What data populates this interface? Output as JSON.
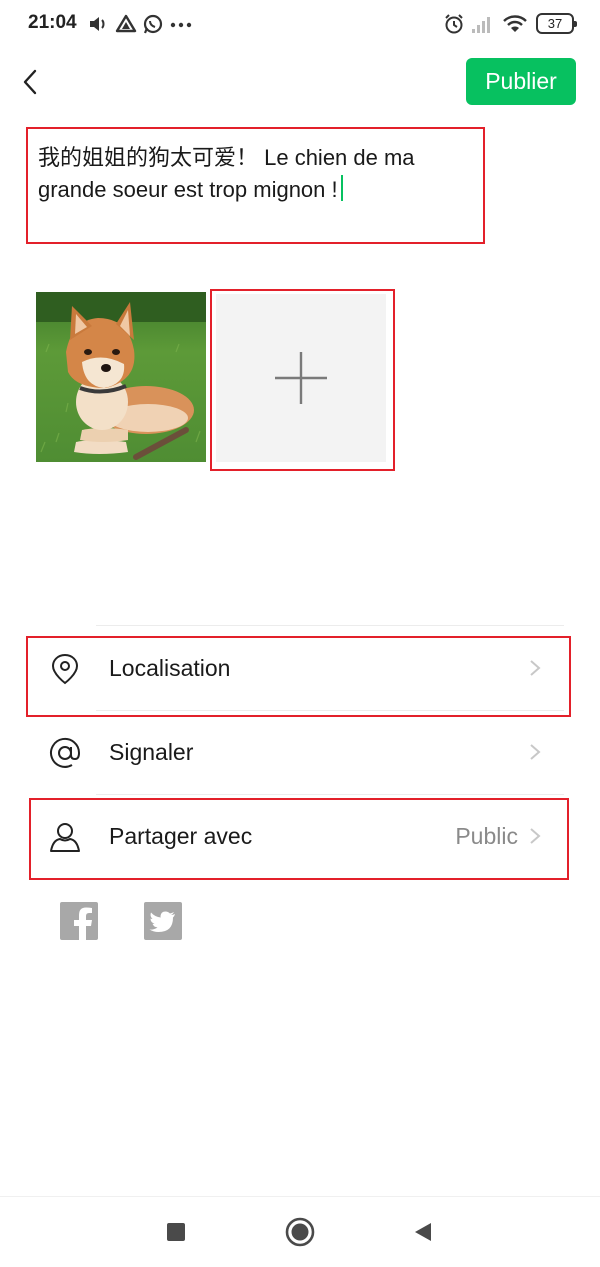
{
  "status_bar": {
    "time": "21:04",
    "battery": "37",
    "icons": [
      "volume-icon",
      "drive-icon",
      "whatsapp-icon",
      "more-dots-icon",
      "alarm-icon",
      "signal-icon",
      "wifi-icon",
      "battery-icon"
    ]
  },
  "header": {
    "back_icon": "chevron-left-icon",
    "publish_label": "Publier",
    "accent_color": "#07c160"
  },
  "post": {
    "text": "我的姐姐的狗太可爱！ Le chien de ma grande soeur est trop mignon !"
  },
  "media": {
    "photo_subject": "shiba-inu-puppy",
    "add_icon": "plus-icon"
  },
  "options": [
    {
      "icon": "location-pin-icon",
      "label": "Localisation",
      "value": ""
    },
    {
      "icon": "at-sign-icon",
      "label": "Signaler",
      "value": ""
    },
    {
      "icon": "person-icon",
      "label": "Partager avec",
      "value": "Public"
    }
  ],
  "share_targets": [
    "facebook-icon",
    "twitter-icon"
  ],
  "highlight_color": "#e3202a",
  "nav_bar": [
    "square-icon",
    "home-circle-icon",
    "back-triangle-icon"
  ]
}
